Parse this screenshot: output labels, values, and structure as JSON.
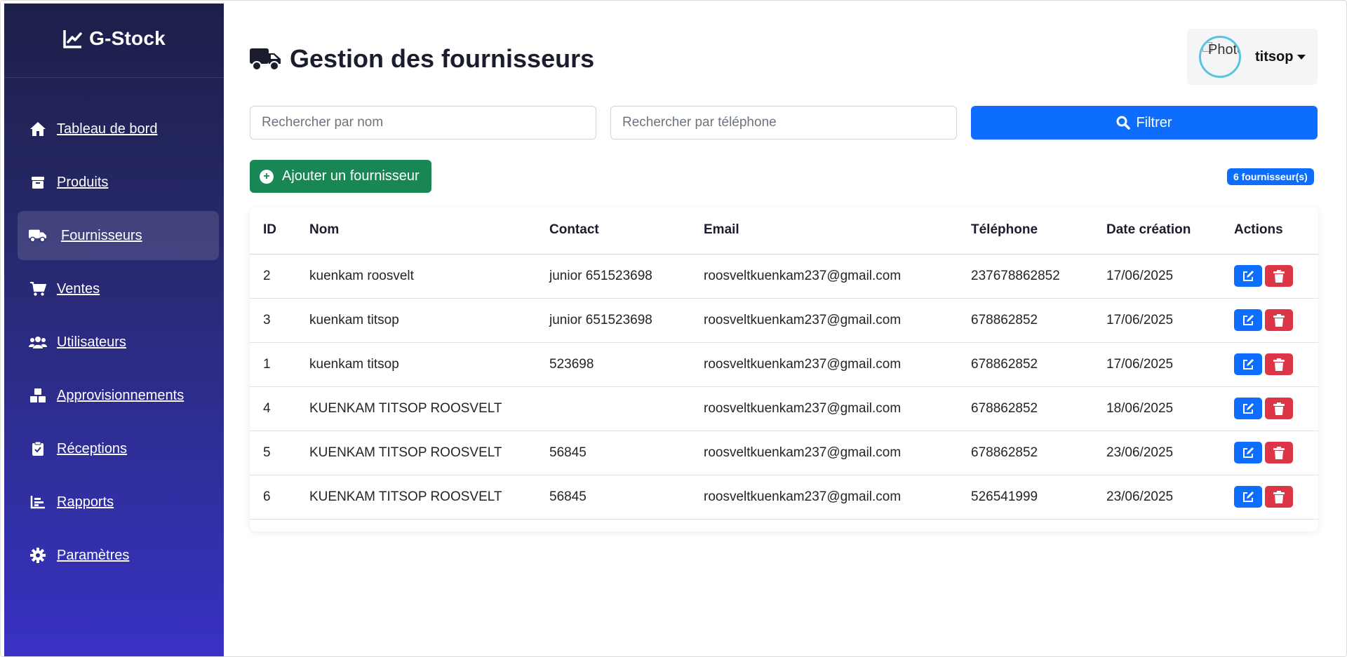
{
  "app": {
    "brand": "G-Stock"
  },
  "sidebar": {
    "items": [
      {
        "label": "Tableau de bord",
        "icon": "home-icon"
      },
      {
        "label": "Produits",
        "icon": "box-icon"
      },
      {
        "label": "Fournisseurs",
        "icon": "truck-icon",
        "active": true
      },
      {
        "label": "Ventes",
        "icon": "cart-icon"
      },
      {
        "label": "Utilisateurs",
        "icon": "users-icon"
      },
      {
        "label": "Approvisionnements",
        "icon": "boxes-icon"
      },
      {
        "label": "Réceptions",
        "icon": "clipboard-check-icon"
      },
      {
        "label": "Rapports",
        "icon": "chart-bar-icon"
      },
      {
        "label": "Paramètres",
        "icon": "gear-icon"
      }
    ]
  },
  "header": {
    "title": "Gestion des fournisseurs",
    "user": {
      "name": "titsop",
      "avatar_alt": "Photo"
    }
  },
  "filters": {
    "name_placeholder": "Rechercher par nom",
    "phone_placeholder": "Rechercher par téléphone",
    "filter_label": "Filtrer"
  },
  "toolbar": {
    "add_label": "Ajouter un fournisseur",
    "count_badge": "6 fournisseur(s)"
  },
  "table": {
    "columns": [
      "ID",
      "Nom",
      "Contact",
      "Email",
      "Téléphone",
      "Date création",
      "Actions"
    ],
    "rows": [
      {
        "id": "2",
        "nom": "kuenkam roosvelt",
        "contact": "junior 651523698",
        "email": "roosveltkuenkam237@gmail.com",
        "tel": "237678862852",
        "date": "17/06/2025"
      },
      {
        "id": "3",
        "nom": "kuenkam titsop",
        "contact": "junior 651523698",
        "email": "roosveltkuenkam237@gmail.com",
        "tel": "678862852",
        "date": "17/06/2025"
      },
      {
        "id": "1",
        "nom": "kuenkam titsop",
        "contact": "523698",
        "email": "roosveltkuenkam237@gmail.com",
        "tel": "678862852",
        "date": "17/06/2025"
      },
      {
        "id": "4",
        "nom": "KUENKAM TITSOP ROOSVELT",
        "contact": "",
        "email": "roosveltkuenkam237@gmail.com",
        "tel": "678862852",
        "date": "18/06/2025"
      },
      {
        "id": "5",
        "nom": "KUENKAM TITSOP ROOSVELT",
        "contact": "56845",
        "email": "roosveltkuenkam237@gmail.com",
        "tel": "678862852",
        "date": "23/06/2025"
      },
      {
        "id": "6",
        "nom": "KUENKAM TITSOP ROOSVELT",
        "contact": "56845",
        "email": "roosveltkuenkam237@gmail.com",
        "tel": "526541999",
        "date": "23/06/2025"
      }
    ]
  },
  "colors": {
    "primary": "#0d6efd",
    "success": "#198754",
    "danger": "#dc3545",
    "sidebar_top": "#1c1f48",
    "sidebar_bottom": "#3a31c4"
  }
}
